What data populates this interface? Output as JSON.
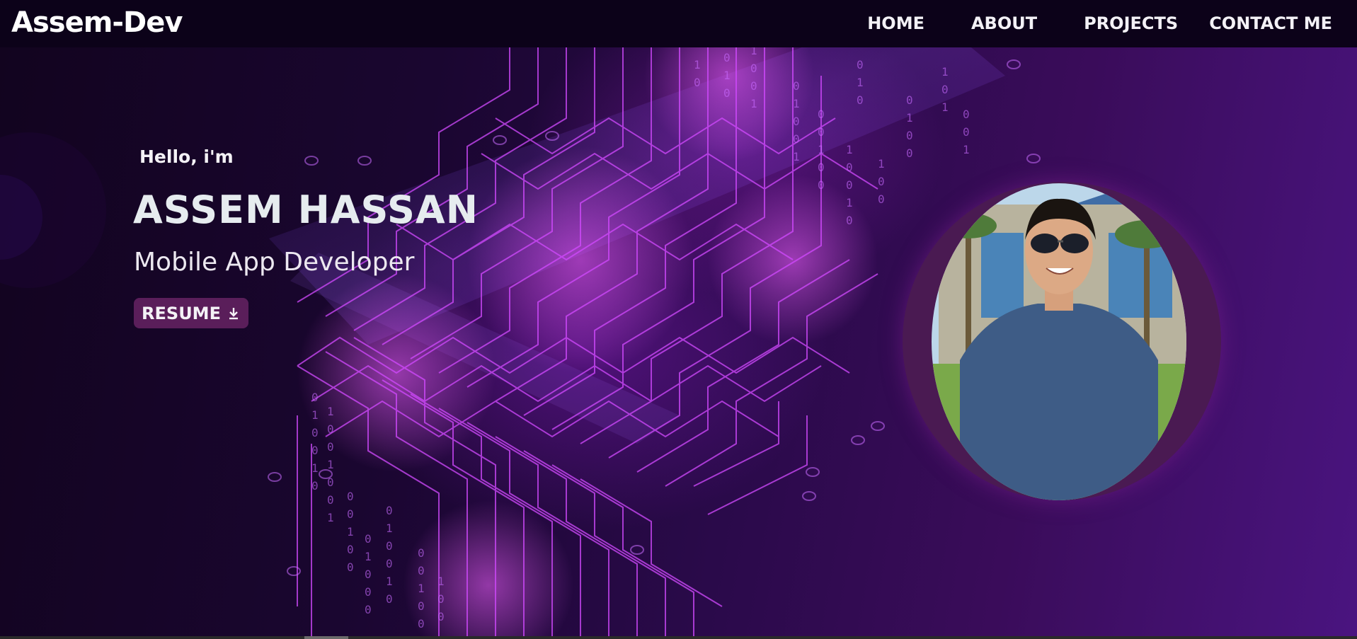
{
  "nav": {
    "logo": "Assem-Dev",
    "links": [
      "HOME",
      "ABOUT",
      "PROJECTS",
      "CONTACT ME"
    ]
  },
  "hero": {
    "intro": "Hello, i'm",
    "name": "ASSEM HASSAN",
    "role": "Mobile App Developer",
    "resume_label": "RESUME",
    "resume_icon": "download-icon"
  },
  "colors": {
    "nav_bg": "#0c0219",
    "accent_button": "#5a1e5a",
    "text_light": "#f4f2f6",
    "circuit_glow": "#d24aff"
  }
}
